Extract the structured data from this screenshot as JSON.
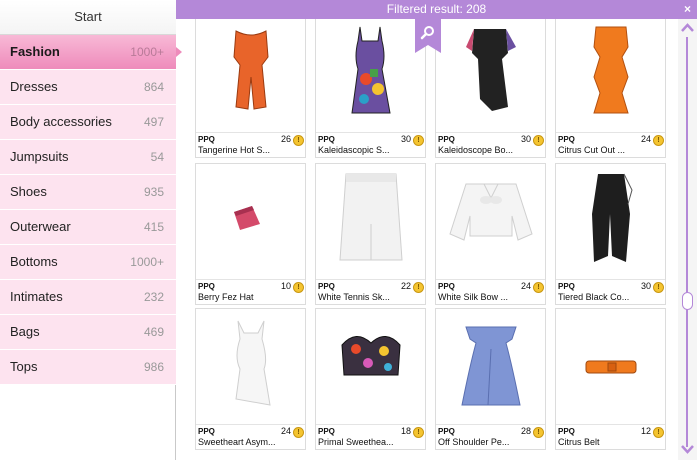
{
  "sidebar": {
    "start_label": "Start",
    "categories": [
      {
        "label": "Fashion",
        "count": "1000+",
        "active": true
      },
      {
        "label": "Dresses",
        "count": "864"
      },
      {
        "label": "Body accessories",
        "count": "497"
      },
      {
        "label": "Jumpsuits",
        "count": "54"
      },
      {
        "label": "Shoes",
        "count": "935"
      },
      {
        "label": "Outerwear",
        "count": "415"
      },
      {
        "label": "Bottoms",
        "count": "1000+"
      },
      {
        "label": "Intimates",
        "count": "232"
      },
      {
        "label": "Bags",
        "count": "469"
      },
      {
        "label": "Tops",
        "count": "986"
      }
    ]
  },
  "header": {
    "result_text": "Filtered result: 208",
    "close_label": "×"
  },
  "colors": {
    "accent": "#b488d8",
    "sidebar_bg": "#fde3ef",
    "sidebar_active": "#ee8bbb",
    "coin": "#f4c430"
  },
  "items": [
    {
      "brand": "PPQ",
      "price": "26",
      "name": "Tangerine Hot S...",
      "icon": "orange-strapless-romper",
      "color": "#e8642a"
    },
    {
      "brand": "PPQ",
      "price": "30",
      "name": "Kaleidascopic S...",
      "icon": "print-strap-dress",
      "color": "#6a4fa0"
    },
    {
      "brand": "PPQ",
      "price": "30",
      "name": "Kaleidoscope Bo...",
      "icon": "black-wrap-dress",
      "color": "#222222"
    },
    {
      "brand": "PPQ",
      "price": "24",
      "name": "Citrus Cut Out ...",
      "icon": "orange-cutout-dress",
      "color": "#f07a1e"
    },
    {
      "brand": "PPQ",
      "price": "10",
      "name": "Berry Fez Hat",
      "icon": "berry-fez-hat",
      "color": "#d44a6a"
    },
    {
      "brand": "PPQ",
      "price": "22",
      "name": "White Tennis Sk...",
      "icon": "white-skirt",
      "color": "#f2f2f2"
    },
    {
      "brand": "PPQ",
      "price": "24",
      "name": "White Silk Bow ...",
      "icon": "white-bow-blouse",
      "color": "#f4f4f4"
    },
    {
      "brand": "PPQ",
      "price": "30",
      "name": "Tiered Black Co...",
      "icon": "black-coat",
      "color": "#1e1e1e"
    },
    {
      "brand": "PPQ",
      "price": "24",
      "name": "Sweetheart Asym...",
      "icon": "white-asym-dress",
      "color": "#f6f6f6"
    },
    {
      "brand": "PPQ",
      "price": "18",
      "name": "Primal Sweethea...",
      "icon": "print-bustier",
      "color": "#3a3040"
    },
    {
      "brand": "PPQ",
      "price": "28",
      "name": "Off Shoulder Pe...",
      "icon": "blue-offshoulder-dress",
      "color": "#7f95d4"
    },
    {
      "brand": "PPQ",
      "price": "12",
      "name": "Citrus Belt",
      "icon": "orange-belt",
      "color": "#f07a1e"
    }
  ],
  "coin_glyph": "!",
  "scroll": {
    "position": 0.65
  }
}
